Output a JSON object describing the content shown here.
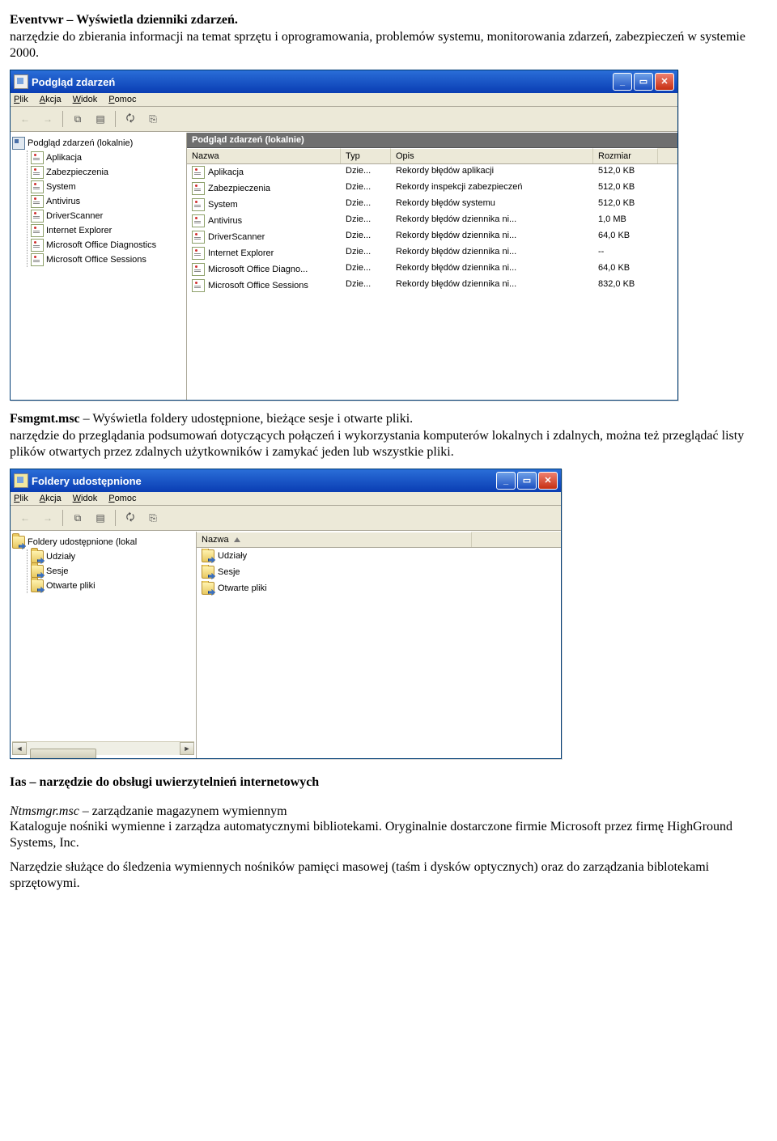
{
  "sections": {
    "eventvwr": {
      "heading": "Eventvwr – Wyświetla dzienniki zdarzeń.",
      "body": "narzędzie do zbierania informacji na temat sprzętu i oprogramowania, problemów systemu, monitorowania zdarzeń, zabezpieczeń w systemie 2000."
    },
    "fsmgmt": {
      "heading": "Fsmgmt.msc",
      "heading_rest": " – Wyświetla foldery udostępnione, bieżące sesje i otwarte pliki.",
      "body": "narzędzie do przeglądania  podsumowań  dotyczących połączeń i wykorzystania komputerów lokalnych i zdalnych, można też przeglądać listy plików otwartych przez zdalnych użytkowników i zamykać jeden lub wszystkie pliki."
    },
    "ias": {
      "heading": "Ias – narzędzie do obsługi uwierzytelnień internetowych"
    },
    "ntmsmgr": {
      "heading": "Ntmsmgr.msc",
      "heading_rest": "  –  zarządzanie magazynem wymiennym",
      "body1": " Kataloguje nośniki wymienne i zarządza automatycznymi bibliotekami. Oryginalnie dostarczone firmie Microsoft przez firmę HighGround Systems, Inc.",
      "body2": "Narzędzie służące do śledzenia wymiennych nośników pamięci masowej (taśm i dysków optycznych) oraz do zarządzania biblotekami sprzętowymi."
    }
  },
  "win1": {
    "title": "Podgląd zdarzeń",
    "menu": [
      "Plik",
      "Akcja",
      "Widok",
      "Pomoc"
    ],
    "treeRoot": "Podgląd zdarzeń (lokalnie)",
    "treeItems": [
      "Aplikacja",
      "Zabezpieczenia",
      "System",
      "Antivirus",
      "DriverScanner",
      "Internet Explorer",
      "Microsoft Office Diagnostics",
      "Microsoft Office Sessions"
    ],
    "banner": "Podgląd zdarzeń (lokalnie)",
    "cols": [
      "Nazwa",
      "Typ",
      "Opis",
      "Rozmiar"
    ],
    "rows": [
      {
        "name": "Aplikacja",
        "type": "Dzie...",
        "desc": "Rekordy błędów aplikacji",
        "size": "512,0 KB"
      },
      {
        "name": "Zabezpieczenia",
        "type": "Dzie...",
        "desc": "Rekordy inspekcji zabezpieczeń",
        "size": "512,0 KB"
      },
      {
        "name": "System",
        "type": "Dzie...",
        "desc": "Rekordy błędów systemu",
        "size": "512,0 KB"
      },
      {
        "name": "Antivirus",
        "type": "Dzie...",
        "desc": "Rekordy błędów dziennika ni...",
        "size": "1,0 MB"
      },
      {
        "name": "DriverScanner",
        "type": "Dzie...",
        "desc": "Rekordy błędów dziennika ni...",
        "size": "64,0 KB"
      },
      {
        "name": "Internet Explorer",
        "type": "Dzie...",
        "desc": "Rekordy błędów dziennika ni...",
        "size": "--"
      },
      {
        "name": "Microsoft Office Diagno...",
        "type": "Dzie...",
        "desc": "Rekordy błędów dziennika ni...",
        "size": "64,0 KB"
      },
      {
        "name": "Microsoft Office Sessions",
        "type": "Dzie...",
        "desc": "Rekordy błędów dziennika ni...",
        "size": "832,0 KB"
      }
    ]
  },
  "win2": {
    "title": "Foldery udostępnione",
    "menu": [
      "Plik",
      "Akcja",
      "Widok",
      "Pomoc"
    ],
    "treeRoot": "Foldery udostępnione (lokal",
    "treeItems": [
      "Udziały",
      "Sesje",
      "Otwarte pliki"
    ],
    "col": "Nazwa",
    "rows": [
      "Udziały",
      "Sesje",
      "Otwarte pliki"
    ]
  }
}
